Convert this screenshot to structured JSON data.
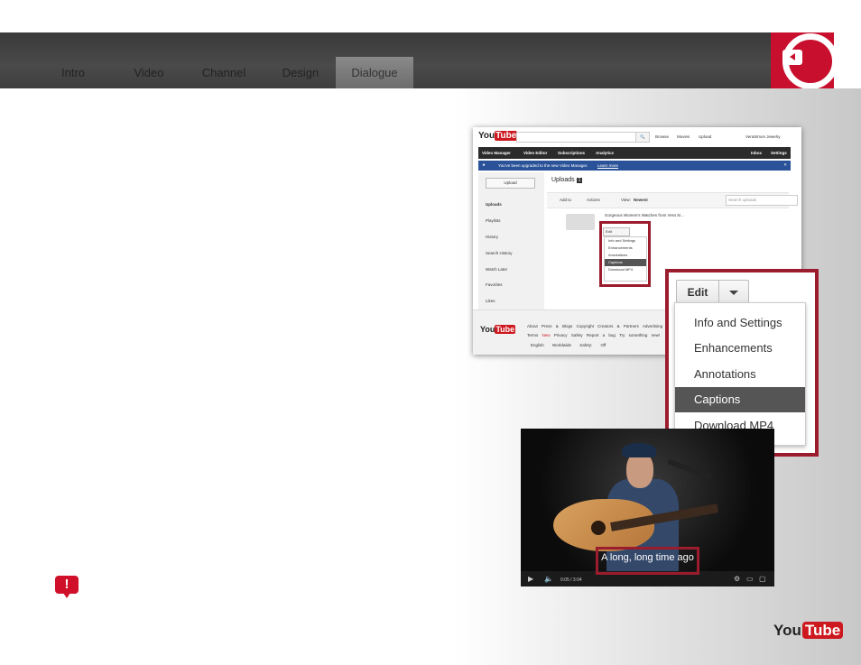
{
  "nav": {
    "tabs": [
      {
        "label": "Intro"
      },
      {
        "label": "Video"
      },
      {
        "label": "Channel"
      },
      {
        "label": "Design"
      },
      {
        "label": "Dialogue",
        "active": true
      }
    ]
  },
  "youtube_screenshot": {
    "logo": {
      "you": "You",
      "tube": "Tube"
    },
    "top_links": [
      "Browse",
      "Movies",
      "Upload"
    ],
    "user": "VeraSimon Jewelry",
    "nav": [
      "Video Manager",
      "Video Editor",
      "Subscriptions",
      "Analytics"
    ],
    "nav_right": [
      "Inbox",
      "Settings"
    ],
    "notice": "You've been upgraded to the new Video Manager.",
    "notice_link": "Learn more",
    "upload_button": "Upload",
    "sidebar": [
      "Uploads",
      "Playlists",
      "History",
      "Search History",
      "Watch Later",
      "Favorites",
      "Likes"
    ],
    "title": "Uploads",
    "count": "1",
    "toolbar": {
      "add_to": "Add to",
      "actions": "Actions",
      "view_label": "View:",
      "view_value": "Newest",
      "search_placeholder": "Search uploads"
    },
    "video_title": "Gorgeous Women's Watches from Vera Si...",
    "mini_edit": "Edit",
    "mini_menu": [
      "Info and Settings",
      "Enhancements",
      "Annotations",
      "Captions",
      "Download MP4"
    ],
    "footer_links_1": [
      "About",
      "Press & Blogs",
      "Copyright",
      "Creators & Partners",
      "Advertising"
    ],
    "footer_links_2": [
      "Terms",
      "New",
      "Privacy",
      "Safety",
      "Report a bug",
      "Try something new!"
    ],
    "footer_selects": [
      "English",
      "Worldwide",
      "Safety: Off"
    ]
  },
  "zoomed_dropdown": {
    "edit_label": "Edit",
    "items": [
      "Info and Settings",
      "Enhancements",
      "Annotations",
      "Captions",
      "Download MP4"
    ],
    "selected_index": 3
  },
  "video": {
    "caption": "A long, long time ago",
    "time": "0:05 / 3:04"
  },
  "bottom_logo": {
    "you": "You",
    "tube": "Tube"
  },
  "colors": {
    "brand_red": "#c8102e",
    "frame_red": "#9b1c2c",
    "topbar": "#3a3a3a"
  }
}
